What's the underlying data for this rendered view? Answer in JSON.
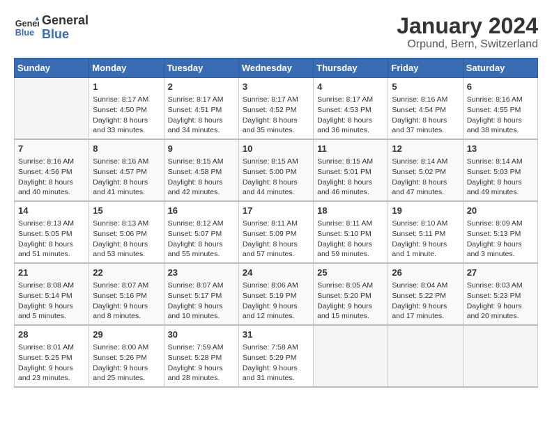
{
  "header": {
    "logo_line1": "General",
    "logo_line2": "Blue",
    "title": "January 2024",
    "subtitle": "Orpund, Bern, Switzerland"
  },
  "calendar": {
    "columns": [
      "Sunday",
      "Monday",
      "Tuesday",
      "Wednesday",
      "Thursday",
      "Friday",
      "Saturday"
    ],
    "weeks": [
      [
        {
          "day": "",
          "info": ""
        },
        {
          "day": "1",
          "info": "Sunrise: 8:17 AM\nSunset: 4:50 PM\nDaylight: 8 hours\nand 33 minutes."
        },
        {
          "day": "2",
          "info": "Sunrise: 8:17 AM\nSunset: 4:51 PM\nDaylight: 8 hours\nand 34 minutes."
        },
        {
          "day": "3",
          "info": "Sunrise: 8:17 AM\nSunset: 4:52 PM\nDaylight: 8 hours\nand 35 minutes."
        },
        {
          "day": "4",
          "info": "Sunrise: 8:17 AM\nSunset: 4:53 PM\nDaylight: 8 hours\nand 36 minutes."
        },
        {
          "day": "5",
          "info": "Sunrise: 8:16 AM\nSunset: 4:54 PM\nDaylight: 8 hours\nand 37 minutes."
        },
        {
          "day": "6",
          "info": "Sunrise: 8:16 AM\nSunset: 4:55 PM\nDaylight: 8 hours\nand 38 minutes."
        }
      ],
      [
        {
          "day": "7",
          "info": "Sunrise: 8:16 AM\nSunset: 4:56 PM\nDaylight: 8 hours\nand 40 minutes."
        },
        {
          "day": "8",
          "info": "Sunrise: 8:16 AM\nSunset: 4:57 PM\nDaylight: 8 hours\nand 41 minutes."
        },
        {
          "day": "9",
          "info": "Sunrise: 8:15 AM\nSunset: 4:58 PM\nDaylight: 8 hours\nand 42 minutes."
        },
        {
          "day": "10",
          "info": "Sunrise: 8:15 AM\nSunset: 5:00 PM\nDaylight: 8 hours\nand 44 minutes."
        },
        {
          "day": "11",
          "info": "Sunrise: 8:15 AM\nSunset: 5:01 PM\nDaylight: 8 hours\nand 46 minutes."
        },
        {
          "day": "12",
          "info": "Sunrise: 8:14 AM\nSunset: 5:02 PM\nDaylight: 8 hours\nand 47 minutes."
        },
        {
          "day": "13",
          "info": "Sunrise: 8:14 AM\nSunset: 5:03 PM\nDaylight: 8 hours\nand 49 minutes."
        }
      ],
      [
        {
          "day": "14",
          "info": "Sunrise: 8:13 AM\nSunset: 5:05 PM\nDaylight: 8 hours\nand 51 minutes."
        },
        {
          "day": "15",
          "info": "Sunrise: 8:13 AM\nSunset: 5:06 PM\nDaylight: 8 hours\nand 53 minutes."
        },
        {
          "day": "16",
          "info": "Sunrise: 8:12 AM\nSunset: 5:07 PM\nDaylight: 8 hours\nand 55 minutes."
        },
        {
          "day": "17",
          "info": "Sunrise: 8:11 AM\nSunset: 5:09 PM\nDaylight: 8 hours\nand 57 minutes."
        },
        {
          "day": "18",
          "info": "Sunrise: 8:11 AM\nSunset: 5:10 PM\nDaylight: 8 hours\nand 59 minutes."
        },
        {
          "day": "19",
          "info": "Sunrise: 8:10 AM\nSunset: 5:11 PM\nDaylight: 9 hours\nand 1 minute."
        },
        {
          "day": "20",
          "info": "Sunrise: 8:09 AM\nSunset: 5:13 PM\nDaylight: 9 hours\nand 3 minutes."
        }
      ],
      [
        {
          "day": "21",
          "info": "Sunrise: 8:08 AM\nSunset: 5:14 PM\nDaylight: 9 hours\nand 5 minutes."
        },
        {
          "day": "22",
          "info": "Sunrise: 8:07 AM\nSunset: 5:16 PM\nDaylight: 9 hours\nand 8 minutes."
        },
        {
          "day": "23",
          "info": "Sunrise: 8:07 AM\nSunset: 5:17 PM\nDaylight: 9 hours\nand 10 minutes."
        },
        {
          "day": "24",
          "info": "Sunrise: 8:06 AM\nSunset: 5:19 PM\nDaylight: 9 hours\nand 12 minutes."
        },
        {
          "day": "25",
          "info": "Sunrise: 8:05 AM\nSunset: 5:20 PM\nDaylight: 9 hours\nand 15 minutes."
        },
        {
          "day": "26",
          "info": "Sunrise: 8:04 AM\nSunset: 5:22 PM\nDaylight: 9 hours\nand 17 minutes."
        },
        {
          "day": "27",
          "info": "Sunrise: 8:03 AM\nSunset: 5:23 PM\nDaylight: 9 hours\nand 20 minutes."
        }
      ],
      [
        {
          "day": "28",
          "info": "Sunrise: 8:01 AM\nSunset: 5:25 PM\nDaylight: 9 hours\nand 23 minutes."
        },
        {
          "day": "29",
          "info": "Sunrise: 8:00 AM\nSunset: 5:26 PM\nDaylight: 9 hours\nand 25 minutes."
        },
        {
          "day": "30",
          "info": "Sunrise: 7:59 AM\nSunset: 5:28 PM\nDaylight: 9 hours\nand 28 minutes."
        },
        {
          "day": "31",
          "info": "Sunrise: 7:58 AM\nSunset: 5:29 PM\nDaylight: 9 hours\nand 31 minutes."
        },
        {
          "day": "",
          "info": ""
        },
        {
          "day": "",
          "info": ""
        },
        {
          "day": "",
          "info": ""
        }
      ]
    ]
  }
}
